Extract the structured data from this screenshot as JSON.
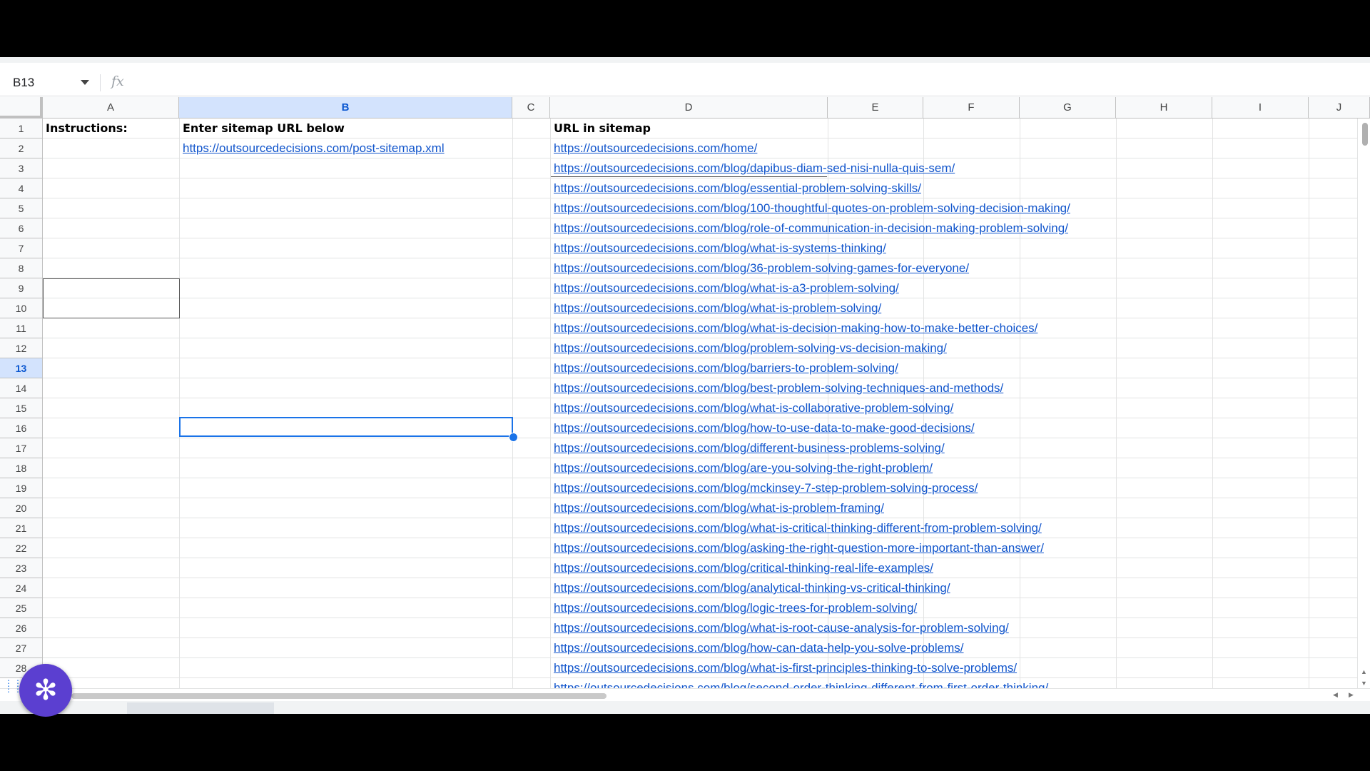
{
  "namebox": "B13",
  "fx_label": "fx",
  "columns": [
    "A",
    "B",
    "C",
    "D",
    "E",
    "F",
    "G",
    "H",
    "I",
    "J"
  ],
  "selected_column": "B",
  "selected_row": "13",
  "rows": [
    "1",
    "2",
    "3",
    "4",
    "5",
    "6",
    "7",
    "8",
    "9",
    "10",
    "11",
    "12",
    "13",
    "14",
    "15",
    "16",
    "17",
    "18",
    "19",
    "20",
    "21",
    "22",
    "23",
    "24",
    "25",
    "26",
    "27",
    "28"
  ],
  "cells": {
    "A1": "Instructions:",
    "B1": "Enter sitemap URL below",
    "B2": "https://outsourcedecisions.com/post-sitemap.xml",
    "D1": "URL in sitemap"
  },
  "sitemap_urls": [
    "https://outsourcedecisions.com/home/",
    "https://outsourcedecisions.com/blog/dapibus-diam-sed-nisi-nulla-quis-sem/",
    "https://outsourcedecisions.com/blog/essential-problem-solving-skills/",
    "https://outsourcedecisions.com/blog/100-thoughtful-quotes-on-problem-solving-decision-making/",
    "https://outsourcedecisions.com/blog/role-of-communication-in-decision-making-problem-solving/",
    "https://outsourcedecisions.com/blog/what-is-systems-thinking/",
    "https://outsourcedecisions.com/blog/36-problem-solving-games-for-everyone/",
    "https://outsourcedecisions.com/blog/what-is-a3-problem-solving/",
    "https://outsourcedecisions.com/blog/what-is-problem-solving/",
    "https://outsourcedecisions.com/blog/what-is-decision-making-how-to-make-better-choices/",
    "https://outsourcedecisions.com/blog/problem-solving-vs-decision-making/",
    "https://outsourcedecisions.com/blog/barriers-to-problem-solving/",
    "https://outsourcedecisions.com/blog/best-problem-solving-techniques-and-methods/",
    "https://outsourcedecisions.com/blog/what-is-collaborative-problem-solving/",
    "https://outsourcedecisions.com/blog/how-to-use-data-to-make-good-decisions/",
    "https://outsourcedecisions.com/blog/different-business-problems-solving/",
    "https://outsourcedecisions.com/blog/are-you-solving-the-right-problem/",
    "https://outsourcedecisions.com/blog/mckinsey-7-step-problem-solving-process/",
    "https://outsourcedecisions.com/blog/what-is-problem-framing/",
    "https://outsourcedecisions.com/blog/what-is-critical-thinking-different-from-problem-solving/",
    "https://outsourcedecisions.com/blog/asking-the-right-question-more-important-than-answer/",
    "https://outsourcedecisions.com/blog/critical-thinking-real-life-examples/",
    "https://outsourcedecisions.com/blog/analytical-thinking-vs-critical-thinking/",
    "https://outsourcedecisions.com/blog/logic-trees-for-problem-solving/",
    "https://outsourcedecisions.com/blog/what-is-root-cause-analysis-for-problem-solving/",
    "https://outsourcedecisions.com/blog/how-can-data-help-you-solve-problems/",
    "https://outsourcedecisions.com/blog/what-is-first-principles-thinking-to-solve-problems/",
    "https://outsourcedecisions.com/blog/second-order-thinking-different-from-first-order-thinking/"
  ],
  "fab_icon": "gear-flower-icon",
  "colors": {
    "link": "#1155cc",
    "selection": "#1a73e8",
    "header_selected": "#d3e3fd",
    "fab": "#5b3fd0"
  }
}
